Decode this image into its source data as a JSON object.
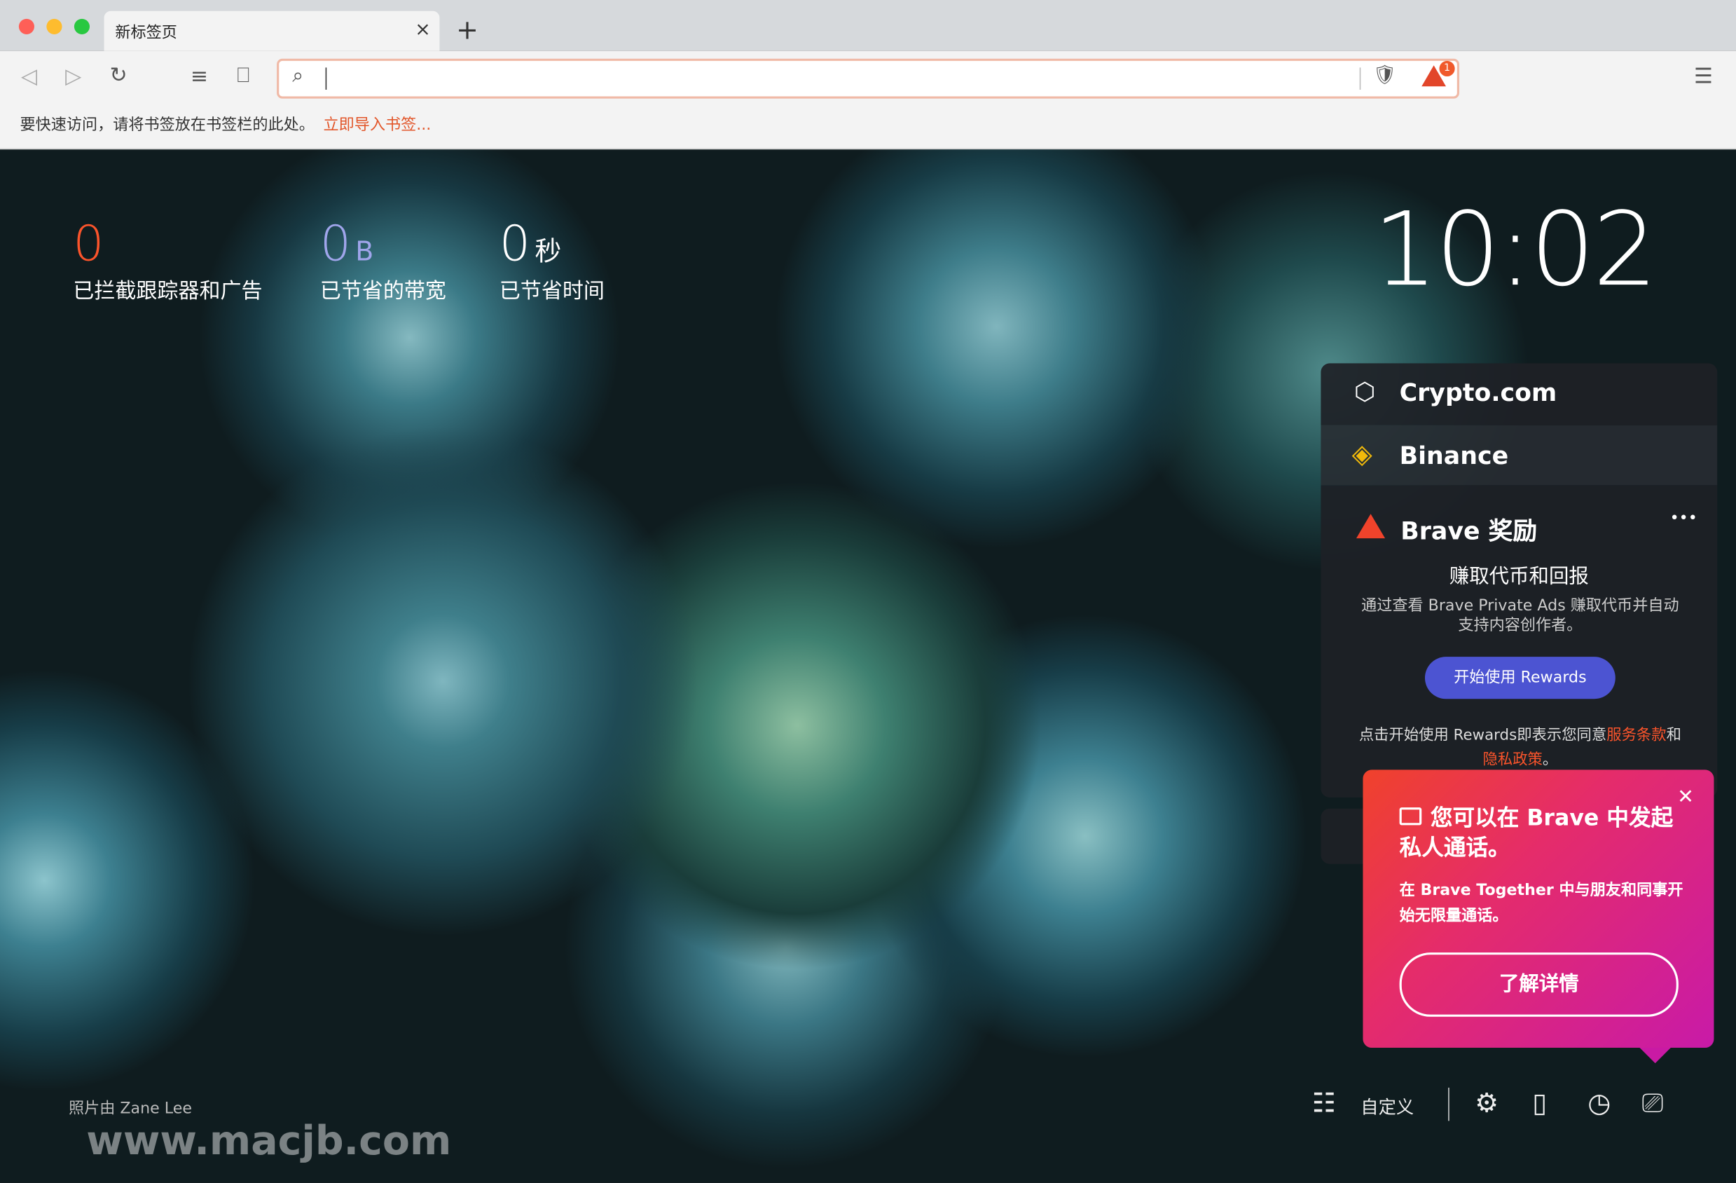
{
  "tab": {
    "title": "新标签页",
    "close": "×",
    "new": "+"
  },
  "toolbar": {
    "back": "◁",
    "forward": "▷",
    "reload": "↻",
    "reader": "≡",
    "bookmark": "⎕",
    "search_icon": "⌕",
    "url_value": "",
    "shields": "🛡",
    "rewards_badge": "1",
    "menu": "☰"
  },
  "bookmarks_bar": {
    "text": "要快速访问，请将书签放在书签栏的此处。",
    "link": "立即导入书签..."
  },
  "stats": [
    {
      "value": "0",
      "unit": "",
      "label": "已拦截跟踪器和广告",
      "color": "#fb542b"
    },
    {
      "value": "0",
      "unit": "B",
      "label": "已节省的带宽",
      "color": "#a0a5eb"
    },
    {
      "value": "0",
      "unit": "秒",
      "label": "已节省时间",
      "color": "#ffffff"
    }
  ],
  "clock": "10:02",
  "widgets": {
    "crypto": "Crypto.com",
    "binance": "Binance",
    "rewards": {
      "title": "Brave 奖励",
      "more": "•••",
      "subtitle": "赚取代币和回报",
      "desc": "通过查看 Brave Private Ads 赚取代币并自动支持内容创作者。",
      "button": "开始使用 Rewards",
      "terms_pre": "点击开始使用 Rewards即表示您同意",
      "terms_link": "服务条款",
      "terms_and": "和",
      "privacy_link": "隐私政策",
      "terms_end": "。"
    }
  },
  "popup": {
    "close": "✕",
    "title": "您可以在 Brave 中发起私人通话。",
    "body": "在 Brave Together 中与朋友和同事开始无限量通话。",
    "button": "了解详情"
  },
  "footer": {
    "credit": "照片由 Zane Lee",
    "customize": "自定义",
    "watermark": "www.macjb.com"
  }
}
